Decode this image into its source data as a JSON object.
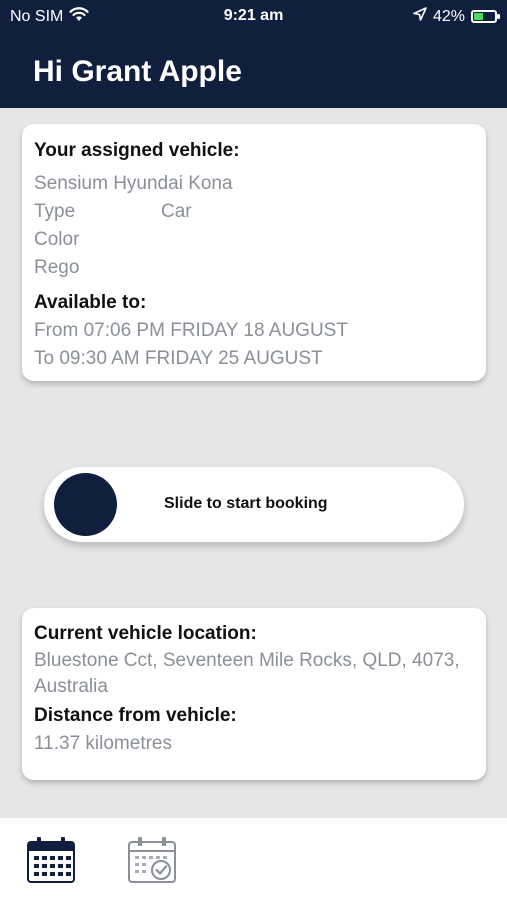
{
  "status_bar": {
    "carrier": "No SIM",
    "time": "9:21 am",
    "battery": "42%"
  },
  "header": {
    "greeting": "Hi Grant Apple"
  },
  "vehicle_card": {
    "title": "Your assigned vehicle:",
    "name": "Sensium Hyundai Kona",
    "type_label": "Type",
    "type_value": "Car",
    "color_label": "Color",
    "rego_label": "Rego",
    "available_title": "Available to:",
    "from": "From 07:06 PM FRIDAY 18 AUGUST",
    "to": "To 09:30 AM FRIDAY 25 AUGUST"
  },
  "slider": {
    "label": "Slide to start booking"
  },
  "location_card": {
    "location_title": "Current vehicle location:",
    "address": "Bluestone Cct, Seventeen Mile Rocks, QLD, 4073, Australia",
    "distance_title": "Distance from vehicle:",
    "distance": "11.37 kilometres"
  },
  "tabs": [
    {
      "icon": "calendar-icon",
      "active": true
    },
    {
      "icon": "calendar-check-icon",
      "active": false
    }
  ],
  "colors": {
    "primary": "#0f1f3d",
    "background": "#e6e6e6",
    "muted_text": "#8a8f98",
    "battery_green": "#4cd964"
  }
}
